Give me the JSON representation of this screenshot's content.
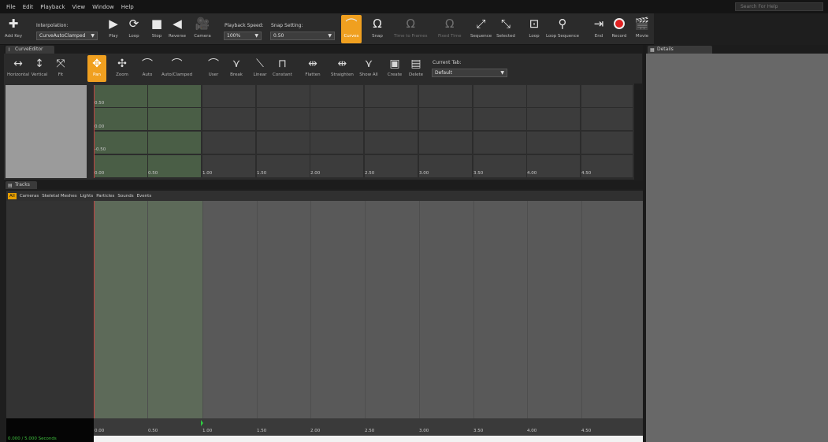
{
  "menu": [
    "File",
    "Edit",
    "Playback",
    "View",
    "Window",
    "Help"
  ],
  "search_placeholder": "Search For Help",
  "toolbar": {
    "add_key": "Add Key",
    "interp_label": "Interpolation:",
    "interp_value": "CurveAutoClamped",
    "play": "Play",
    "loop": "Loop",
    "stop": "Stop",
    "reverse": "Reverse",
    "camera": "Camera",
    "speed_label": "Playback Speed:",
    "speed_value": "100%",
    "snap_label": "Snap Setting:",
    "snap_value": "0.50",
    "curves": "Curves",
    "snap": "Snap",
    "time_to_frames": "Time to Frames",
    "fixed_time": "Fixed Time",
    "sequence": "Sequence",
    "selected": "Selected",
    "loop2": "Loop",
    "loop_sequence": "Loop Sequence",
    "end": "End",
    "record": "Record",
    "movie": "Movie"
  },
  "curve_editor": {
    "tab": "CurveEditor",
    "buttons": [
      "Horizontal",
      "Vertical",
      "Fit",
      "Pan",
      "Zoom",
      "Auto",
      "Auto/Clamped",
      "User",
      "Break",
      "Linear",
      "Constant",
      "Flatten",
      "Straighten",
      "Show All",
      "Create",
      "Delete"
    ],
    "current_tab_label": "Current Tab:",
    "current_tab_value": "Default",
    "y_labels": [
      "0.50",
      "0.00",
      "-0.50"
    ],
    "x_labels": [
      "0.00",
      "0.50",
      "1.00",
      "1.50",
      "2.00",
      "2.50",
      "3.00",
      "3.50",
      "4.00",
      "4.50"
    ]
  },
  "tracks": {
    "tab": "Tracks",
    "filters": [
      "All",
      "Cameras",
      "Skeletal Meshes",
      "Lights",
      "Particles",
      "Sounds",
      "Events"
    ],
    "x_labels": [
      "0.00",
      "0.50",
      "1.00",
      "1.50",
      "2.00",
      "2.50",
      "3.00",
      "3.50",
      "4.00",
      "4.50"
    ],
    "time_readout": "0.000 / 5.000 Seconds"
  },
  "details": {
    "tab": "Details"
  },
  "colors": {
    "accent": "#f0a020",
    "green_region": "#4a5e46",
    "time_text": "#3ec03e"
  }
}
